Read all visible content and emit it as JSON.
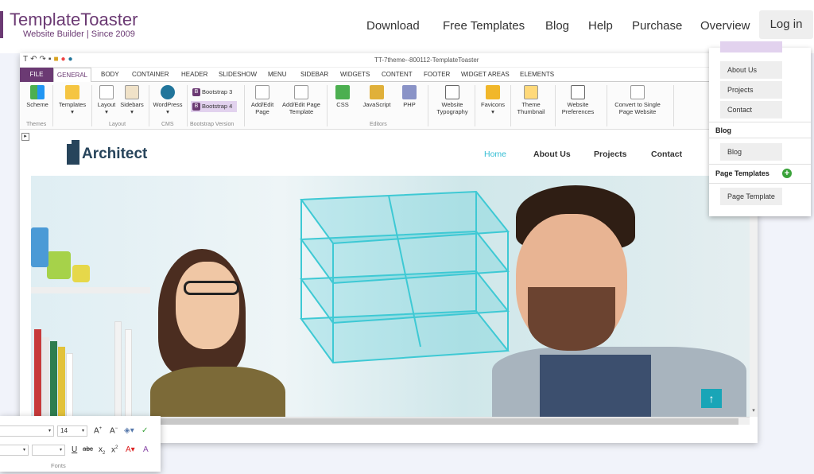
{
  "site": {
    "brand": "TemplateToaster",
    "tagline": "Website Builder | Since 2009",
    "nav": [
      "Download",
      "Free Templates",
      "Blog",
      "Help",
      "Purchase",
      "Overview"
    ],
    "login": "Log in"
  },
  "app": {
    "window_title": "TT-7theme--800112-TemplateToaster",
    "tabs": [
      "FILE",
      "GENERAL",
      "BODY",
      "CONTAINER",
      "HEADER",
      "SLIDESHOW",
      "MENU",
      "SIDEBAR",
      "WIDGETS",
      "CONTENT",
      "FOOTER",
      "WIDGET AREAS",
      "ELEMENTS"
    ],
    "ribbon": {
      "scheme": "Scheme",
      "templates": "Templates",
      "layout": "Layout",
      "sidebars": "Sidebars",
      "wordpress": "WordPress",
      "bootstrap3": "Bootstrap 3",
      "bootstrap4": "Bootstrap 4",
      "add_edit_page": "Add/Edit Page",
      "add_edit_page_template": "Add/Edit Page Template",
      "css": "CSS",
      "javascript": "JavaScript",
      "php": "PHP",
      "website_typography": "Website Typography",
      "favicons": "Favicons",
      "theme_thumbnail": "Theme Thumbnail",
      "website_preferences": "Website Preferences",
      "convert_single": "Convert to Single Page Website",
      "groups": {
        "themes": "Themes",
        "layout": "Layout",
        "cms": "CMS",
        "bootstrap_version": "Bootstrap Version",
        "editors": "Editors"
      }
    }
  },
  "preview": {
    "logo": "Architect",
    "nav": [
      "Home",
      "About Us",
      "Projects",
      "Contact"
    ],
    "scroll_top_icon": "↑"
  },
  "side_panel": {
    "items_top": [
      "About Us",
      "Projects",
      "Contact"
    ],
    "blog_heading": "Blog",
    "blog_item": "Blog",
    "page_templates_heading": "Page Templates",
    "page_template_item": "Page Template"
  },
  "fonts_panel": {
    "size": "14",
    "label": "Fonts"
  }
}
